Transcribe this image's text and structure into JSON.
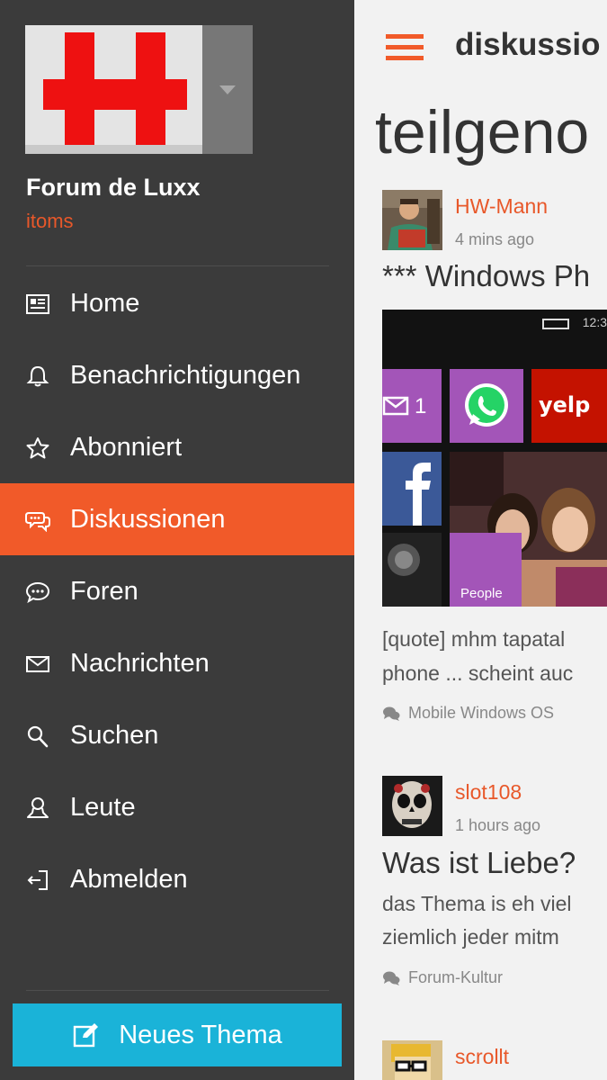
{
  "sidebar": {
    "forum_name": "Forum de Luxx",
    "username": "itoms",
    "nav": [
      {
        "label": "Home",
        "icon": "newspaper-icon",
        "active": false
      },
      {
        "label": "Benachrichtigungen",
        "icon": "bell-icon",
        "active": false
      },
      {
        "label": "Abonniert",
        "icon": "star-icon",
        "active": false
      },
      {
        "label": "Diskussionen",
        "icon": "discussion-icon",
        "active": true
      },
      {
        "label": "Foren",
        "icon": "speech-bubble-icon",
        "active": false
      },
      {
        "label": "Nachrichten",
        "icon": "envelope-icon",
        "active": false
      },
      {
        "label": "Suchen",
        "icon": "search-icon",
        "active": false
      },
      {
        "label": "Leute",
        "icon": "person-icon",
        "active": false
      },
      {
        "label": "Abmelden",
        "icon": "logout-icon",
        "active": false
      }
    ],
    "new_topic_label": "Neues Thema"
  },
  "main": {
    "title": "diskussio",
    "heading": "teilgeno",
    "posts": [
      {
        "author": "HW-Mann",
        "time": "4 mins ago",
        "title": "*** Windows Ph",
        "snippet_lines": [
          "[quote] mhm tapatal",
          "phone ... scheint auc"
        ],
        "category": "Mobile Windows OS",
        "preview": {
          "status_time": "12:3",
          "mail_count": "1",
          "people_label": "People"
        }
      },
      {
        "author": "slot108",
        "time": "1 hours ago",
        "title": "Was ist Liebe?",
        "snippet_lines": [
          "das Thema is eh viel",
          "ziemlich jeder mitm"
        ],
        "category": "Forum-Kultur"
      },
      {
        "author": "scrollt"
      }
    ]
  },
  "colors": {
    "accent": "#f15a29",
    "sidebar_bg": "#3b3b3b",
    "new_topic_bg": "#1ab3d8",
    "main_bg": "#f2f2f2"
  }
}
